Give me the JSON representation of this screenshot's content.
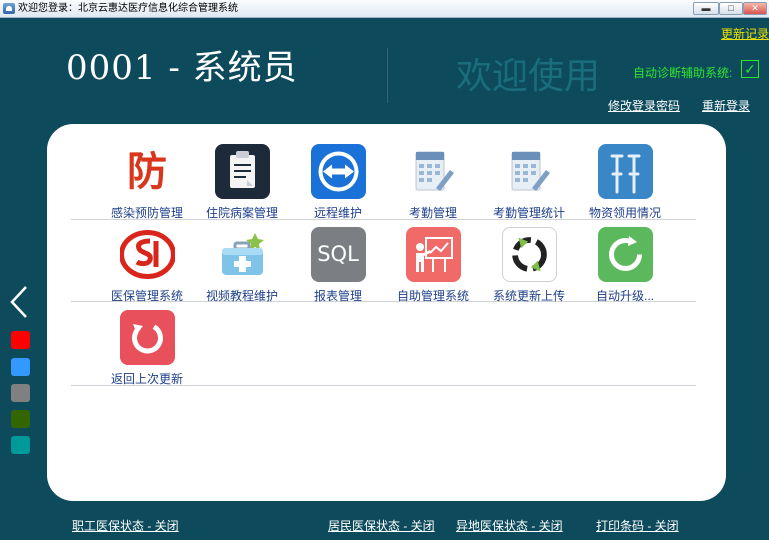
{
  "window": {
    "title": "欢迎您登录：北京云惠达医疗信息化综合管理系统",
    "min_glyph": "▬",
    "max_glyph": "□",
    "close_glyph": "✕"
  },
  "header": {
    "user_title": "0001 - 系统员",
    "welcome": "欢迎使用",
    "update_log": "更新记录",
    "auto_diag_label": "自动诊断辅助系统:",
    "auto_diag_checked": true,
    "auto_diag_check_glyph": "✓",
    "change_password": "修改登录密码",
    "relogin": "重新登录"
  },
  "modules": [
    {
      "label": "感染预防管理",
      "icon": "fang-character-icon",
      "glyph": "防"
    },
    {
      "label": "住院病案管理",
      "icon": "clipboard-icon"
    },
    {
      "label": "远程维护",
      "icon": "teamviewer-icon"
    },
    {
      "label": "考勤管理",
      "icon": "attendance-calendar-icon"
    },
    {
      "label": "考勤管理统计",
      "icon": "attendance-stats-icon"
    },
    {
      "label": "物资领用情况",
      "icon": "crutches-icon"
    },
    {
      "label": "医保管理系统",
      "icon": "social-insurance-logo-icon"
    },
    {
      "label": "视频教程维护",
      "icon": "medical-kit-icon"
    },
    {
      "label": "报表管理",
      "icon": "sql-icon",
      "glyph": "SQL"
    },
    {
      "label": "自助管理系统",
      "icon": "presentation-board-icon"
    },
    {
      "label": "系统更新上传",
      "icon": "sync-arrows-icon"
    },
    {
      "label": "自动升级...",
      "icon": "refresh-icon"
    },
    {
      "label": "返回上次更新",
      "icon": "undo-icon"
    }
  ],
  "side": {
    "arrow_icon": "chevron-left-icon",
    "swatches": [
      "#ff0000",
      "#3399ff",
      "#808080",
      "#336600",
      "#009999",
      "#0d4b5c"
    ]
  },
  "footer": {
    "employee_insurance": "职工医保状态 - 关闭",
    "resident_insurance": "居民医保状态 - 关闭",
    "remote_insurance": "异地医保状态 - 关闭",
    "print_barcode": "打印条码 - 关闭"
  }
}
